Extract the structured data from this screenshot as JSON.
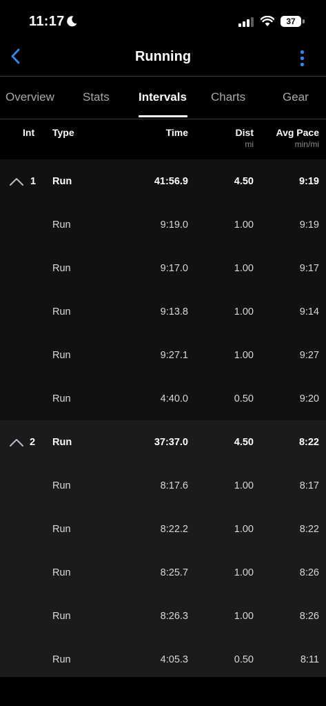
{
  "status_bar": {
    "time": "11:17",
    "battery": "37"
  },
  "nav": {
    "title": "Running"
  },
  "tabs": [
    {
      "label": "Overview",
      "active": false
    },
    {
      "label": "Stats",
      "active": false
    },
    {
      "label": "Intervals",
      "active": true
    },
    {
      "label": "Charts",
      "active": false
    },
    {
      "label": "Gear",
      "active": false
    }
  ],
  "columns": {
    "int": "Int",
    "type": "Type",
    "time": "Time",
    "dist": "Dist",
    "dist_unit": "mi",
    "pace": "Avg Pace",
    "pace_unit": "min/mi"
  },
  "intervals": [
    {
      "number": "1",
      "summary": {
        "type": "Run",
        "time": "41:56.9",
        "dist": "4.50",
        "pace": "9:19"
      },
      "laps": [
        {
          "type": "Run",
          "time": "9:19.0",
          "dist": "1.00",
          "pace": "9:19"
        },
        {
          "type": "Run",
          "time": "9:17.0",
          "dist": "1.00",
          "pace": "9:17"
        },
        {
          "type": "Run",
          "time": "9:13.8",
          "dist": "1.00",
          "pace": "9:14"
        },
        {
          "type": "Run",
          "time": "9:27.1",
          "dist": "1.00",
          "pace": "9:27"
        },
        {
          "type": "Run",
          "time": "4:40.0",
          "dist": "0.50",
          "pace": "9:20"
        }
      ]
    },
    {
      "number": "2",
      "summary": {
        "type": "Run",
        "time": "37:37.0",
        "dist": "4.50",
        "pace": "8:22"
      },
      "laps": [
        {
          "type": "Run",
          "time": "8:17.6",
          "dist": "1.00",
          "pace": "8:17"
        },
        {
          "type": "Run",
          "time": "8:22.2",
          "dist": "1.00",
          "pace": "8:22"
        },
        {
          "type": "Run",
          "time": "8:25.7",
          "dist": "1.00",
          "pace": "8:26"
        },
        {
          "type": "Run",
          "time": "8:26.3",
          "dist": "1.00",
          "pace": "8:26"
        },
        {
          "type": "Run",
          "time": "4:05.3",
          "dist": "0.50",
          "pace": "8:11"
        }
      ]
    }
  ],
  "colors": {
    "accent": "#2c8cf4",
    "background": "#000000",
    "group_1_bg": "#111111",
    "group_2_bg": "#1b1b1d"
  }
}
